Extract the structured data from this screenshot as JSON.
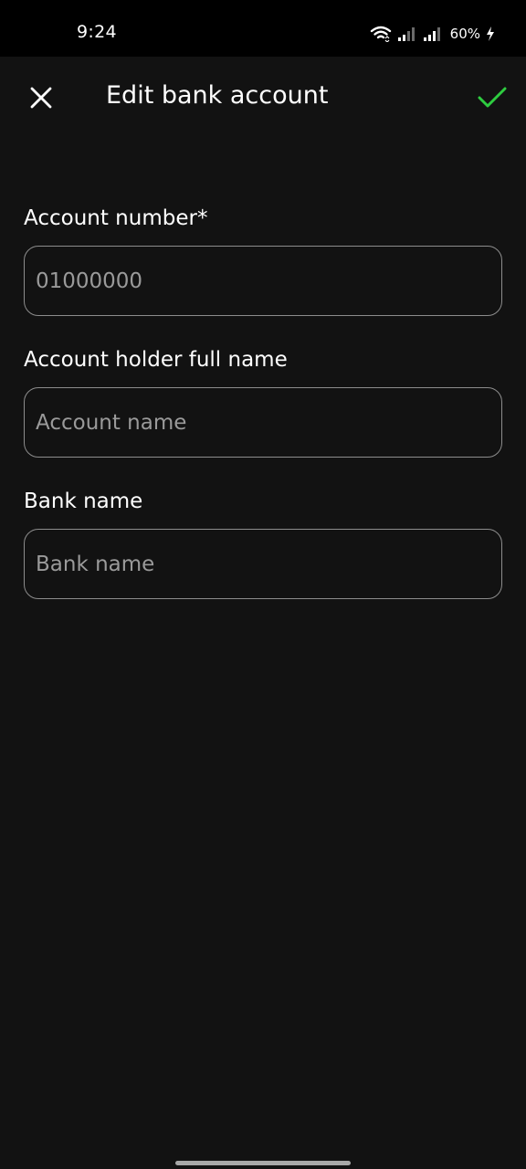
{
  "status_bar": {
    "time": "9:24",
    "battery": "60%",
    "icons": [
      "wifi-icon",
      "signal-icon",
      "signal-icon",
      "charging-icon"
    ]
  },
  "header": {
    "title": "Edit bank account",
    "close_icon": "close-icon",
    "confirm_icon": "check-icon",
    "confirm_color": "#2ecc40"
  },
  "form": {
    "account_number": {
      "label": "Account number*",
      "placeholder": "01000000",
      "value": ""
    },
    "account_holder": {
      "label": "Account holder full name",
      "placeholder": "Account name",
      "value": ""
    },
    "bank_name": {
      "label": "Bank name",
      "placeholder": "Bank name",
      "value": ""
    }
  }
}
